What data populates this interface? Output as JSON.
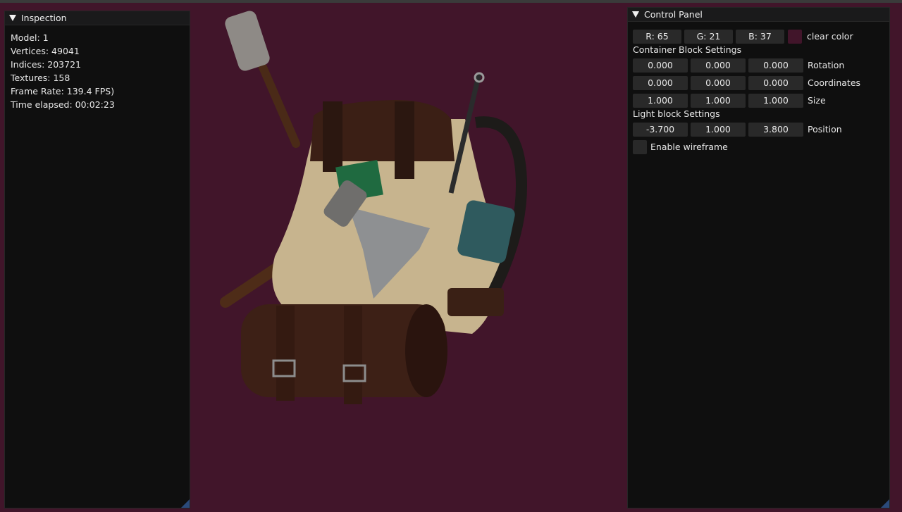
{
  "inspection": {
    "title": "Inspection",
    "stats": [
      "Model: 1",
      "Vertices: 49041",
      "Indices: 203721",
      "Textures: 158",
      "Frame Rate: 139.4 FPS)",
      "Time elapsed: 00:02:23"
    ]
  },
  "control_panel": {
    "title": "Control Panel",
    "clear_color": {
      "r": "R: 65",
      "g": "G: 21",
      "b": "B: 37",
      "label": "clear color",
      "swatch_color": "#41152a"
    },
    "container_header": "Container Block Settings",
    "rotation": {
      "x": "0.000",
      "y": "0.000",
      "z": "0.000",
      "label": "Rotation"
    },
    "coordinates": {
      "x": "0.000",
      "y": "0.000",
      "z": "0.000",
      "label": "Coordinates"
    },
    "size": {
      "x": "1.000",
      "y": "1.000",
      "z": "1.000",
      "label": "Size"
    },
    "light_header": "Light block Settings",
    "position": {
      "x": "-3.700",
      "y": "1.000",
      "z": "3.800",
      "label": "Position"
    },
    "wireframe": {
      "label": "Enable wireframe",
      "checked": false
    }
  },
  "viewport": {
    "background_color": "#41152a",
    "model": "backpack"
  }
}
